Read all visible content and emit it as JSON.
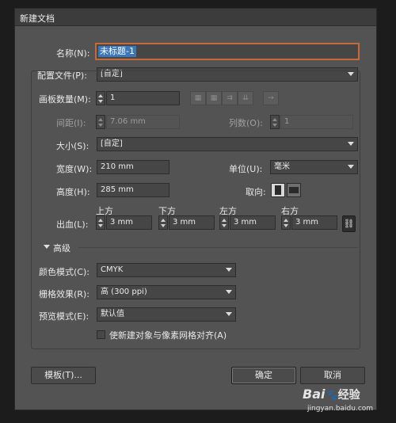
{
  "window": {
    "title": "新建文档"
  },
  "name": {
    "label": "名称(N):",
    "value": "未标题-1"
  },
  "profile": {
    "label": "配置文件(P):",
    "value": "[自定]"
  },
  "artboards": {
    "label": "画板数量(M):",
    "value": "1"
  },
  "spacing": {
    "label": "间距(I):",
    "value": "7.06 mm"
  },
  "columns": {
    "label": "列数(O):",
    "value": "1"
  },
  "size": {
    "label": "大小(S):",
    "value": "[自定]"
  },
  "width": {
    "label": "宽度(W):",
    "value": "210 mm"
  },
  "units": {
    "label": "单位(U):",
    "value": "毫米"
  },
  "height": {
    "label": "高度(H):",
    "value": "285 mm"
  },
  "orientation": {
    "label": "取向:",
    "selected": "portrait"
  },
  "bleed": {
    "label": "出血(L):",
    "top": {
      "label": "上方",
      "value": "3 mm"
    },
    "bottom": {
      "label": "下方",
      "value": "3 mm"
    },
    "left": {
      "label": "左方",
      "value": "3 mm"
    },
    "right": {
      "label": "右方",
      "value": "3 mm"
    }
  },
  "advanced": {
    "label": "高级",
    "color_mode": {
      "label": "颜色模式(C):",
      "value": "CMYK"
    },
    "raster": {
      "label": "栅格效果(R):",
      "value": "高 (300 ppi)"
    },
    "preview": {
      "label": "预览模式(E):",
      "value": "默认值"
    },
    "align_pixel": {
      "label": "使新建对象与像素网格对齐(A)",
      "checked": false
    }
  },
  "buttons": {
    "templates": "模板(T)...",
    "ok": "确定",
    "cancel": "取消"
  },
  "watermark": {
    "brand": "Bai",
    "brand2": "经验",
    "url": "jingyan.baidu.com"
  },
  "colors": {
    "window_bg": "#535353",
    "field_bg": "#464646",
    "selection": "#3d76b7",
    "focus_ring": "#c8693a"
  }
}
